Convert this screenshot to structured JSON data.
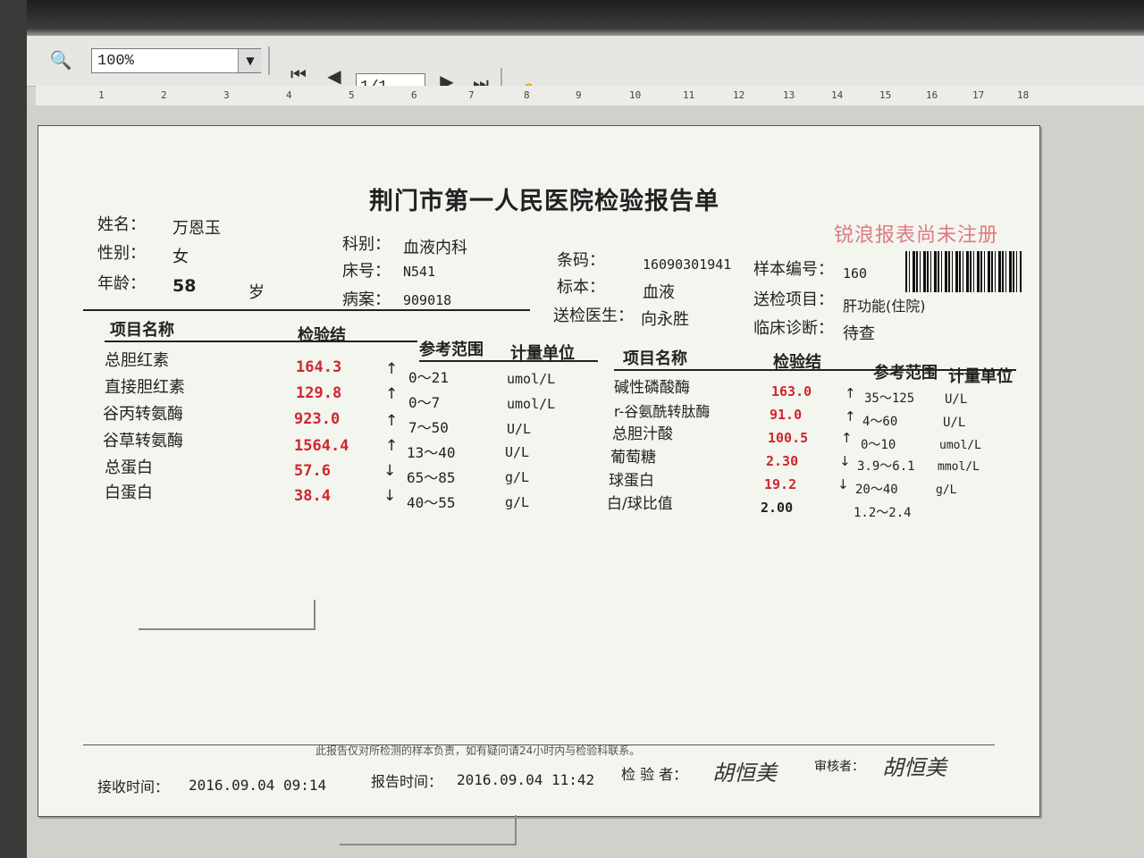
{
  "toolbar": {
    "zoom": "100%",
    "page": "1/1",
    "icons": [
      "search-icon",
      "first-page-icon",
      "prev-page-icon",
      "next-page-icon",
      "last-page-icon",
      "hand-tool-icon",
      "text-select-icon",
      "copy-icon",
      "close-icon"
    ]
  },
  "ruler": [
    "1",
    "2",
    "3",
    "4",
    "5",
    "6",
    "7",
    "8",
    "9",
    "10",
    "11",
    "12",
    "13",
    "14",
    "15",
    "16",
    "17",
    "18"
  ],
  "report": {
    "title": "荆门市第一人民医院检验报告单",
    "watermark": "锐浪报表尚未注册",
    "patient": {
      "name_label": "姓名：",
      "name": "万恩玉",
      "sex_label": "性别：",
      "sex": "女",
      "age_label": "年龄：",
      "age": "58",
      "age_unit": "岁"
    },
    "dept_label": "科别：",
    "dept": "血液内科",
    "bed_label": "床号：",
    "bed": "N541",
    "case_label": "病案：",
    "case": "909018",
    "barcode_label": "条码：",
    "barcode": "16090301941",
    "specimen_label": "标本：",
    "specimen": "血液",
    "doctor_label": "送检医生：",
    "doctor": "向永胜",
    "sample_no_label": "样本编号：",
    "sample_no": "160",
    "test_item_label": "送检项目：",
    "test_item": "肝功能(住院)",
    "diagnosis_label": "临床诊断：",
    "diagnosis": "待查",
    "headers": {
      "name": "项目名称",
      "result": "检验结",
      "range": "参考范围",
      "unit": "计量单位"
    },
    "left_rows": [
      {
        "name": "总胆红素",
        "result": "164.3",
        "flag": "↑",
        "range": "0～21",
        "unit": "umol/L"
      },
      {
        "name": "直接胆红素",
        "result": "129.8",
        "flag": "↑",
        "range": "0～7",
        "unit": "umol/L"
      },
      {
        "name": "谷丙转氨酶",
        "result": "923.0",
        "flag": "↑",
        "range": "7～50",
        "unit": "U/L"
      },
      {
        "name": "谷草转氨酶",
        "result": "1564.4",
        "flag": "↑",
        "range": "13～40",
        "unit": "U/L"
      },
      {
        "name": "总蛋白",
        "result": "57.6",
        "flag": "↓",
        "range": "65～85",
        "unit": "g/L"
      },
      {
        "name": "白蛋白",
        "result": "38.4",
        "flag": "↓",
        "range": "40～55",
        "unit": "g/L"
      }
    ],
    "right_rows": [
      {
        "name": "碱性磷酸酶",
        "result": "163.0",
        "flag": "↑",
        "range": "35～125",
        "unit": "U/L"
      },
      {
        "name": "r-谷氨酰转肽酶",
        "result": "91.0",
        "flag": "↑",
        "range": "4～60",
        "unit": "U/L"
      },
      {
        "name": "总胆汁酸",
        "result": "100.5",
        "flag": "↑",
        "range": "0～10",
        "unit": "umol/L"
      },
      {
        "name": "葡萄糖",
        "result": "2.30",
        "flag": "↓",
        "range": "3.9～6.1",
        "unit": "mmol/L"
      },
      {
        "name": "球蛋白",
        "result": "19.2",
        "flag": "↓",
        "range": "20～40",
        "unit": "g/L"
      },
      {
        "name": "白/球比值",
        "result": "2.00",
        "flag": "",
        "range": "1.2～2.4",
        "unit": ""
      }
    ],
    "footer_note": "此报告仅对所检测的样本负责，如有疑问请24小时内与检验科联系。",
    "receive_label": "接收时间：",
    "receive_time": "2016.09.04 09:14",
    "report_label": "报告时间：",
    "report_time": "2016.09.04 11:42",
    "tester_label": "检 验 者：",
    "tester_sig": "胡恒美",
    "reviewer_label": "审核者：",
    "reviewer_sig": "胡恒美"
  }
}
